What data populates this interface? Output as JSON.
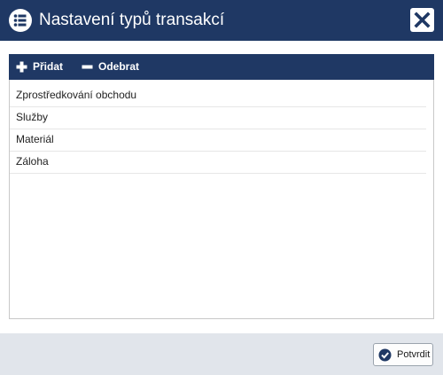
{
  "dialog": {
    "title": "Nastavení typů transakcí",
    "title_icon": "list-icon",
    "close_icon": "close-icon"
  },
  "toolbar": {
    "add_label": "Přidat",
    "add_icon": "plus-icon",
    "remove_label": "Odebrat",
    "remove_icon": "minus-icon"
  },
  "list": {
    "items": [
      {
        "label": "Zprostředkování obchodu"
      },
      {
        "label": "Služby"
      },
      {
        "label": "Materiál"
      },
      {
        "label": "Záloha"
      }
    ]
  },
  "footer": {
    "confirm_label": "Potvrdit",
    "confirm_icon": "check-circle-icon"
  },
  "colors": {
    "header": "#1f3864",
    "footer": "#e1e5eb",
    "border": "#c8c8c8"
  }
}
